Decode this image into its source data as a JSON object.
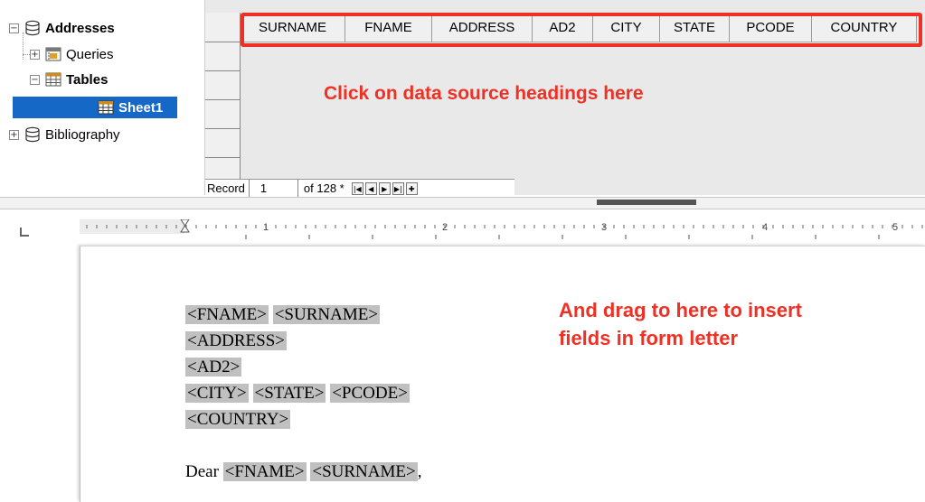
{
  "tree": {
    "items": [
      {
        "label": "Addresses",
        "expander": "−",
        "icon": "database-icon"
      },
      {
        "label": "Queries",
        "expander": "+",
        "icon": "queries-icon"
      },
      {
        "label": "Tables",
        "expander": "−",
        "icon": "table-icon"
      },
      {
        "label": "Sheet1",
        "icon": "table-icon"
      },
      {
        "label": "Bibliography",
        "expander": "+",
        "icon": "database-icon"
      }
    ]
  },
  "grid": {
    "columns": [
      "SURNAME",
      "FNAME",
      "ADDRESS",
      "AD2",
      "CITY",
      "STATE",
      "PCODE",
      "COUNTRY"
    ]
  },
  "navigator": {
    "record_label": "Record",
    "record_value": "1",
    "of_text": "of 128 *"
  },
  "ruler": {
    "numbers": [
      "1",
      "2",
      "3",
      "4",
      "5"
    ]
  },
  "annotations": {
    "click_note": "Click on data source headings here",
    "drag_note_line1": "And drag to here to insert",
    "drag_note_line2": "fields in form letter",
    "color": "#ee3124"
  },
  "letter": {
    "lines": [
      [
        "<FNAME>",
        "<SURNAME>"
      ],
      [
        "<ADDRESS>"
      ],
      [
        "<AD2>"
      ],
      [
        "<CITY>",
        "<STATE>",
        "<PCODE>"
      ],
      [
        "<COUNTRY>"
      ]
    ],
    "greeting_prefix": "Dear",
    "greeting_fields": [
      "<FNAME>",
      "<SURNAME>"
    ],
    "greeting_suffix": ","
  }
}
